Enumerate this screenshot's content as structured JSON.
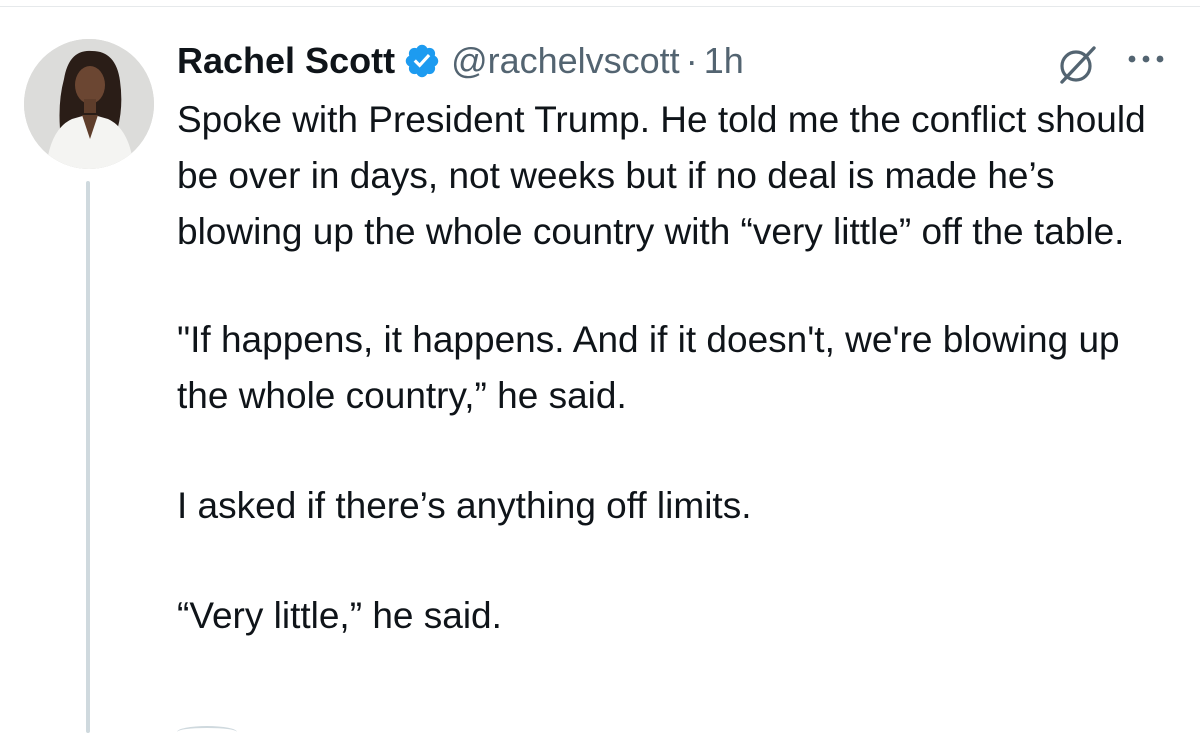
{
  "tweet": {
    "author": {
      "display_name": "Rachel Scott",
      "handle": "@rachelvscott",
      "verified": true,
      "avatar_icon": "profile-photo"
    },
    "separator": "·",
    "timestamp": "1h",
    "paragraphs": [
      "Spoke with President Trump. He told me the conflict should be over in days, not weeks but if no deal is made he’s blowing up the whole country with “very little” off the table.",
      "\"If happens, it happens. And if it doesn't, we're blowing up the whole country,” he said.",
      "I asked if there’s anything off limits.",
      "“Very little,” he said."
    ],
    "actions": {
      "grok_icon": "grok-icon",
      "more_icon": "more-icon"
    }
  },
  "colors": {
    "verified_blue": "#1d9bf0",
    "text_primary": "#0f1419",
    "text_secondary": "#536471",
    "thread_line": "#cfd9de"
  }
}
